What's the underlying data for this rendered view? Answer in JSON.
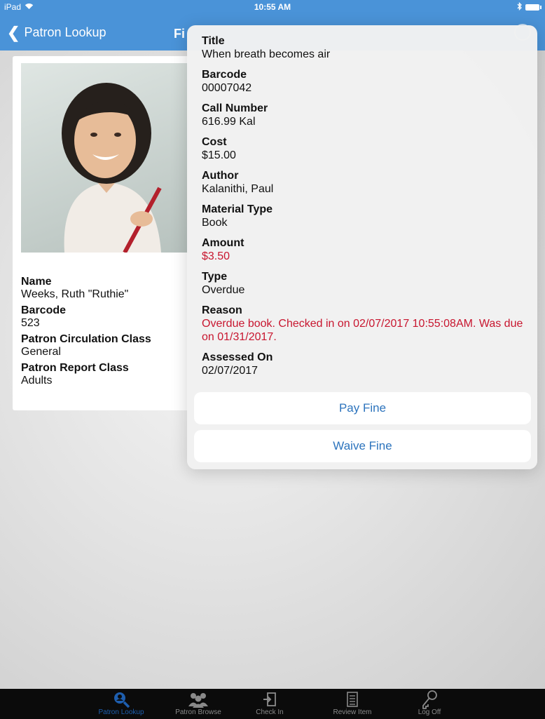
{
  "status_bar": {
    "device": "iPad",
    "time": "10:55 AM"
  },
  "nav": {
    "back_label": "Patron Lookup",
    "title_partial": "Fi"
  },
  "patron": {
    "fields": [
      {
        "label": "Name",
        "value": "Weeks, Ruth \"Ruthie\""
      },
      {
        "label": "Barcode",
        "value": "523"
      },
      {
        "label": "Patron Circulation Class",
        "value": "General"
      },
      {
        "label": "Patron Report Class",
        "value": "Adults"
      }
    ]
  },
  "fine_detail": {
    "fields": [
      {
        "label": "Title",
        "value": "When breath becomes air"
      },
      {
        "label": "Barcode",
        "value": "00007042"
      },
      {
        "label": "Call Number",
        "value": "616.99 Kal"
      },
      {
        "label": "Cost",
        "value": "$15.00"
      },
      {
        "label": "Author",
        "value": "Kalanithi, Paul"
      },
      {
        "label": "Material Type",
        "value": "Book"
      },
      {
        "label": "Amount",
        "value": "$3.50"
      },
      {
        "label": "Type",
        "value": "Overdue"
      },
      {
        "label": "Reason",
        "value": "Overdue book. Checked in on 02/07/2017 10:55:08AM. Was due on 01/31/2017."
      },
      {
        "label": "Assessed On",
        "value": "02/07/2017"
      }
    ],
    "pay_label": "Pay Fine",
    "waive_label": "Waive Fine"
  },
  "tabs": [
    {
      "label": "Patron Lookup",
      "icon": "magnifier-person-icon",
      "active": true
    },
    {
      "label": "Patron Browse",
      "icon": "people-group-icon",
      "active": false
    },
    {
      "label": "Check In",
      "icon": "check-in-icon",
      "active": false
    },
    {
      "label": "Review Item",
      "icon": "document-list-icon",
      "active": false
    },
    {
      "label": "Log Off",
      "icon": "key-icon",
      "active": false
    }
  ],
  "colors": {
    "nav_blue": "#4a93d8",
    "link_blue": "#2d74bd",
    "alert_red": "#c8162f",
    "tab_active": "#1e5eae"
  }
}
